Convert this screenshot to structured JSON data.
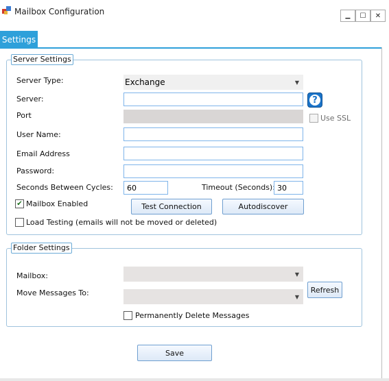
{
  "window": {
    "title": "Mailbox Configuration",
    "minimize_glyph": "▁",
    "maximize_glyph": "☐",
    "close_glyph": "✕"
  },
  "tabs": [
    {
      "label": "Settings",
      "active": true
    }
  ],
  "server_settings": {
    "legend": "Server Settings",
    "server_type_label": "Server Type:",
    "server_type_value": "Exchange",
    "server_label": "Server:",
    "server_value": "",
    "port_label": "Port",
    "port_value": "",
    "use_ssl_label": "Use SSL",
    "use_ssl_checked": false,
    "user_name_label": "User Name:",
    "user_name_value": "",
    "email_label": "Email Address",
    "email_value": "",
    "password_label": "Password:",
    "password_value": "",
    "seconds_label": "Seconds Between Cycles:",
    "seconds_value": "60",
    "timeout_label": "Timeout (Seconds):",
    "timeout_value": "30",
    "mailbox_enabled_label": "Mailbox Enabled",
    "mailbox_enabled_checked": true,
    "load_testing_label": "Load Testing (emails will not be moved or deleted)",
    "load_testing_checked": false,
    "test_connection_label": "Test Connection",
    "autodiscover_label": "Autodiscover",
    "help_glyph": "?"
  },
  "folder_settings": {
    "legend": "Folder Settings",
    "mailbox_label": "Mailbox:",
    "mailbox_value": "",
    "move_label": "Move Messages To:",
    "move_value": "",
    "refresh_label": "Refresh",
    "perm_delete_label": "Permanently Delete Messages",
    "perm_delete_checked": false
  },
  "save_label": "Save",
  "colors": {
    "accent": "#2ea0da",
    "field_border": "#7eb4ea",
    "disabled_fill": "#d9d6d5"
  }
}
